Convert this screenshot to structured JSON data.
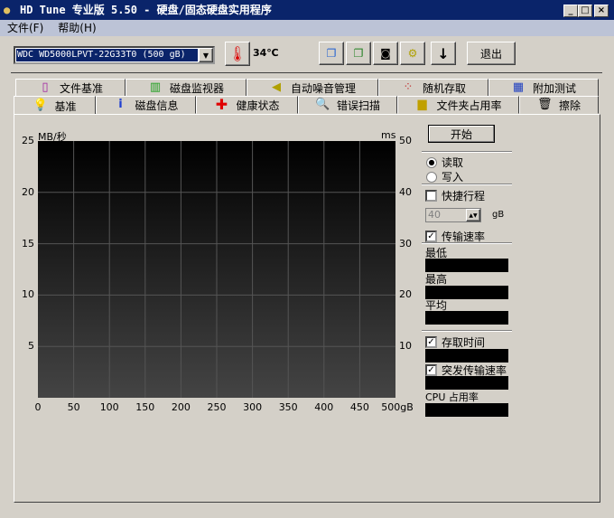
{
  "window": {
    "title": "HD Tune 专业版 5.50 - 硬盘/固态硬盘实用程序",
    "minimize": "_",
    "maximize": "□",
    "close": "×"
  },
  "menu": {
    "file": "文件(F)",
    "help": "帮助(H)"
  },
  "toolbar": {
    "drive": "WDC WD5000LPVT-22G33T0 (500 gB)",
    "temperature": "34℃",
    "exit": "退出",
    "icons": [
      "copy-text-icon",
      "copy-screenshot-icon",
      "camera-icon",
      "options-icon",
      "download-icon"
    ]
  },
  "tabs_row1": [
    "文件基准",
    "磁盘监视器",
    "自动噪音管理",
    "随机存取",
    "附加测试"
  ],
  "tabs_row2": [
    "基准",
    "磁盘信息",
    "健康状态",
    "错误扫描",
    "文件夹占用率",
    "擦除"
  ],
  "controls": {
    "start": "开始",
    "read": "读取",
    "write": "写入",
    "read_selected": true,
    "short_stroke": "快捷行程",
    "short_stroke_checked": false,
    "short_stroke_value": "40",
    "short_stroke_unit": "gB",
    "transfer_rate": "传输速率",
    "transfer_rate_checked": true,
    "min": "最低",
    "max": "最高",
    "avg": "平均",
    "access_time": "存取时间",
    "access_time_checked": true,
    "burst_rate": "突发传输速率",
    "burst_rate_checked": true,
    "cpu": "CPU 占用率"
  },
  "chart_data": {
    "type": "line",
    "series": [],
    "ylabel": "MB/秒",
    "y2label": "ms",
    "ylim": [
      0,
      25
    ],
    "y2lim": [
      0,
      50
    ],
    "xlim": [
      0,
      500
    ],
    "yticks": [
      "25",
      "20",
      "15",
      "10",
      "5"
    ],
    "y2ticks": [
      "50",
      "40",
      "30",
      "20",
      "10"
    ],
    "xticks": [
      "0",
      "50",
      "100",
      "150",
      "200",
      "250",
      "300",
      "350",
      "400",
      "450",
      "500gB"
    ],
    "grid": true
  }
}
